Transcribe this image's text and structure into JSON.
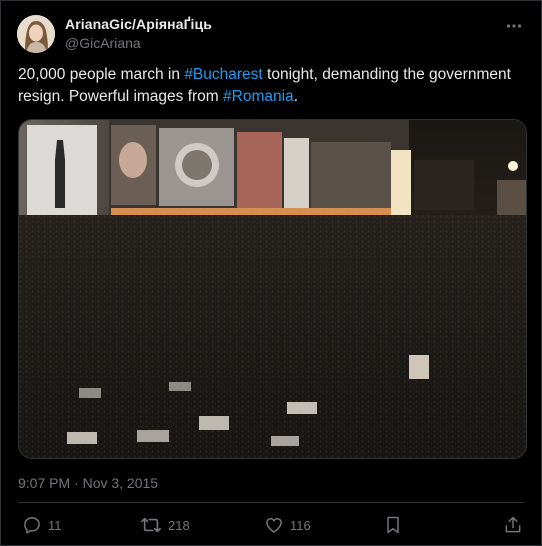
{
  "author": {
    "display_name": "ArianaGic/АріянаҐіць",
    "handle": "@GicAriana"
  },
  "tweet": {
    "text_parts": [
      {
        "text": "20,000 people march in ",
        "type": "plain"
      },
      {
        "text": "#Bucharest",
        "type": "hashtag"
      },
      {
        "text": " tonight, demanding the government resign. Powerful images from ",
        "type": "plain"
      },
      {
        "text": "#Romania",
        "type": "hashtag"
      },
      {
        "text": ".",
        "type": "plain"
      }
    ],
    "timestamp": "9:07 PM · Nov 3, 2015"
  },
  "actions": {
    "replies": "11",
    "retweets": "218",
    "likes": "116"
  },
  "icons": {
    "more": "more-horizontal-icon",
    "reply": "reply-icon",
    "retweet": "retweet-icon",
    "like": "heart-icon",
    "bookmark": "bookmark-icon",
    "share": "share-icon"
  },
  "colors": {
    "background": "#000000",
    "text": "#e7e9ea",
    "muted": "#71767b",
    "link": "#1d9bf0",
    "border": "#2f3336"
  }
}
